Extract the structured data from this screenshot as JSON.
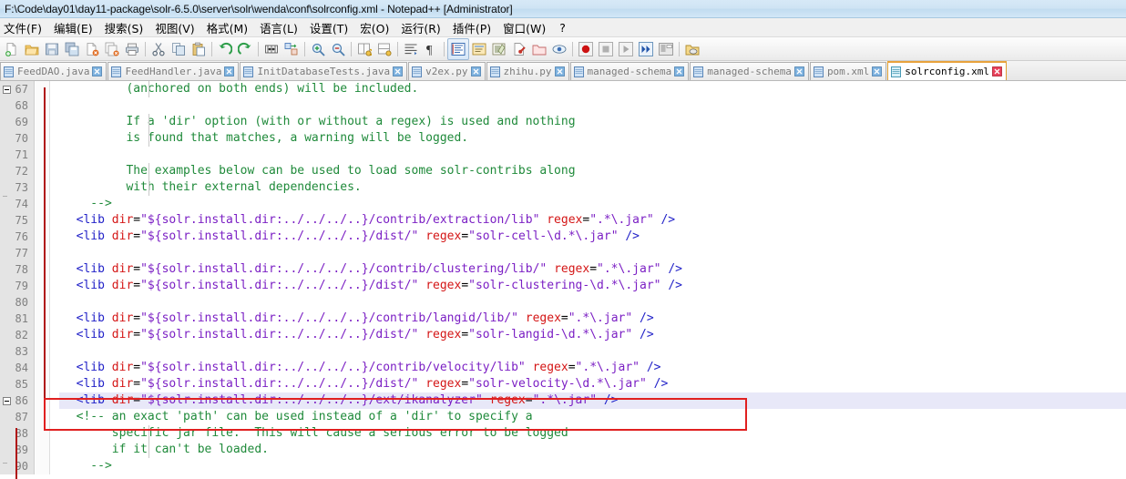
{
  "window": {
    "title": "F:\\Code\\day01\\day11-package\\solr-6.5.0\\server\\solr\\wenda\\conf\\solrconfig.xml - Notepad++ [Administrator]"
  },
  "menu": {
    "items": [
      {
        "label": "文件(F)",
        "name": "menu-file"
      },
      {
        "label": "编辑(E)",
        "name": "menu-edit"
      },
      {
        "label": "搜索(S)",
        "name": "menu-search"
      },
      {
        "label": "视图(V)",
        "name": "menu-view"
      },
      {
        "label": "格式(M)",
        "name": "menu-format"
      },
      {
        "label": "语言(L)",
        "name": "menu-language"
      },
      {
        "label": "设置(T)",
        "name": "menu-settings"
      },
      {
        "label": "宏(O)",
        "name": "menu-macro"
      },
      {
        "label": "运行(R)",
        "name": "menu-run"
      },
      {
        "label": "插件(P)",
        "name": "menu-plugins"
      },
      {
        "label": "窗口(W)",
        "name": "menu-window"
      },
      {
        "label": "?",
        "name": "menu-help"
      }
    ]
  },
  "toolbar": {
    "icons": [
      "new-file-icon",
      "open-file-icon",
      "save-icon",
      "save-all-icon",
      "close-file-icon",
      "close-all-icon",
      "print-icon",
      "sep",
      "cut-icon",
      "copy-icon",
      "paste-icon",
      "sep",
      "undo-icon",
      "redo-icon",
      "sep",
      "find-icon",
      "replace-icon",
      "sep",
      "zoom-in-icon",
      "zoom-out-icon",
      "sep",
      "sync-vertical-icon",
      "sync-horizontal-icon",
      "sep",
      "word-wrap-icon",
      "show-all-chars-icon",
      "sep",
      "indent-guide-icon",
      "ui-shift-icon",
      "show-doc-map-icon",
      "function-list-icon",
      "folder-as-workspace-icon",
      "show-whitespace-icon",
      "sep",
      "record-macro-icon",
      "stop-record-icon",
      "playback-macro-icon",
      "run-multi-macro-icon",
      "save-macro-icon",
      "sep",
      "run-icon"
    ]
  },
  "tabs": [
    {
      "label": "FeedDAO.java",
      "active": false,
      "icon": "document-icon",
      "name": "tab-feeddao-java"
    },
    {
      "label": "FeedHandler.java",
      "active": false,
      "icon": "document-icon",
      "name": "tab-feedhandler-java"
    },
    {
      "label": "InitDatabaseTests.java",
      "active": false,
      "icon": "document-icon",
      "name": "tab-initdatabasetests-java"
    },
    {
      "label": "v2ex.py",
      "active": false,
      "icon": "document-icon",
      "name": "tab-v2ex-py"
    },
    {
      "label": "zhihu.py",
      "active": false,
      "icon": "document-icon",
      "name": "tab-zhihu-py"
    },
    {
      "label": "managed-schema",
      "active": false,
      "icon": "document-icon",
      "name": "tab-managed-schema-1"
    },
    {
      "label": "managed-schema",
      "active": false,
      "icon": "document-icon",
      "name": "tab-managed-schema-2"
    },
    {
      "label": "pom.xml",
      "active": false,
      "icon": "document-icon",
      "name": "tab-pom-xml"
    },
    {
      "label": "solrconfig.xml",
      "active": true,
      "icon": "document-icon",
      "name": "tab-solrconfig-xml"
    }
  ],
  "editor": {
    "first_line_number": 67,
    "current_line_number": 86,
    "line_numbers": [
      67,
      68,
      69,
      70,
      71,
      72,
      73,
      74,
      75,
      76,
      77,
      78,
      79,
      80,
      81,
      82,
      83,
      84,
      85,
      86,
      87,
      88,
      89,
      90
    ],
    "lines": [
      {
        "n": 67,
        "segments": [
          {
            "t": "         (anchored on both ends) will be included.",
            "c": "cmt"
          }
        ]
      },
      {
        "n": 68,
        "segments": [
          {
            "t": "",
            "c": "cmt"
          }
        ]
      },
      {
        "n": 69,
        "segments": [
          {
            "t": "         If a 'dir' option (with or without a regex) is used and nothing",
            "c": "cmt"
          }
        ]
      },
      {
        "n": 70,
        "segments": [
          {
            "t": "         is found that matches, a warning will be logged.",
            "c": "cmt"
          }
        ]
      },
      {
        "n": 71,
        "segments": [
          {
            "t": "",
            "c": "cmt"
          }
        ]
      },
      {
        "n": 72,
        "segments": [
          {
            "t": "         The examples below can be used to load some solr-contribs along",
            "c": "cmt"
          }
        ]
      },
      {
        "n": 73,
        "segments": [
          {
            "t": "         with their external dependencies.",
            "c": "cmt"
          }
        ]
      },
      {
        "n": 74,
        "segments": [
          {
            "t": "    -->",
            "c": "cmt"
          }
        ]
      },
      {
        "n": 75,
        "segments": [
          {
            "t": "  <lib ",
            "c": "tag"
          },
          {
            "t": "dir",
            "c": "att"
          },
          {
            "t": "=",
            "c": "txt"
          },
          {
            "t": "\"${solr.install.dir:../../../..}/contrib/extraction/lib\"",
            "c": "val"
          },
          {
            "t": " ",
            "c": "txt"
          },
          {
            "t": "regex",
            "c": "att"
          },
          {
            "t": "=",
            "c": "txt"
          },
          {
            "t": "\".*\\.jar\"",
            "c": "val"
          },
          {
            "t": " ",
            "c": "txt"
          },
          {
            "t": "/>",
            "c": "tag"
          }
        ]
      },
      {
        "n": 76,
        "segments": [
          {
            "t": "  <lib ",
            "c": "tag"
          },
          {
            "t": "dir",
            "c": "att"
          },
          {
            "t": "=",
            "c": "txt"
          },
          {
            "t": "\"${solr.install.dir:../../../..}/dist/\"",
            "c": "val"
          },
          {
            "t": " ",
            "c": "txt"
          },
          {
            "t": "regex",
            "c": "att"
          },
          {
            "t": "=",
            "c": "txt"
          },
          {
            "t": "\"solr-cell-\\d.*\\.jar\"",
            "c": "val"
          },
          {
            "t": " ",
            "c": "txt"
          },
          {
            "t": "/>",
            "c": "tag"
          }
        ]
      },
      {
        "n": 77,
        "segments": [
          {
            "t": "",
            "c": "txt"
          }
        ]
      },
      {
        "n": 78,
        "segments": [
          {
            "t": "  <lib ",
            "c": "tag"
          },
          {
            "t": "dir",
            "c": "att"
          },
          {
            "t": "=",
            "c": "txt"
          },
          {
            "t": "\"${solr.install.dir:../../../..}/contrib/clustering/lib/\"",
            "c": "val"
          },
          {
            "t": " ",
            "c": "txt"
          },
          {
            "t": "regex",
            "c": "att"
          },
          {
            "t": "=",
            "c": "txt"
          },
          {
            "t": "\".*\\.jar\"",
            "c": "val"
          },
          {
            "t": " ",
            "c": "txt"
          },
          {
            "t": "/>",
            "c": "tag"
          }
        ]
      },
      {
        "n": 79,
        "segments": [
          {
            "t": "  <lib ",
            "c": "tag"
          },
          {
            "t": "dir",
            "c": "att"
          },
          {
            "t": "=",
            "c": "txt"
          },
          {
            "t": "\"${solr.install.dir:../../../..}/dist/\"",
            "c": "val"
          },
          {
            "t": " ",
            "c": "txt"
          },
          {
            "t": "regex",
            "c": "att"
          },
          {
            "t": "=",
            "c": "txt"
          },
          {
            "t": "\"solr-clustering-\\d.*\\.jar\"",
            "c": "val"
          },
          {
            "t": " ",
            "c": "txt"
          },
          {
            "t": "/>",
            "c": "tag"
          }
        ]
      },
      {
        "n": 80,
        "segments": [
          {
            "t": "",
            "c": "txt"
          }
        ]
      },
      {
        "n": 81,
        "segments": [
          {
            "t": "  <lib ",
            "c": "tag"
          },
          {
            "t": "dir",
            "c": "att"
          },
          {
            "t": "=",
            "c": "txt"
          },
          {
            "t": "\"${solr.install.dir:../../../..}/contrib/langid/lib/\"",
            "c": "val"
          },
          {
            "t": " ",
            "c": "txt"
          },
          {
            "t": "regex",
            "c": "att"
          },
          {
            "t": "=",
            "c": "txt"
          },
          {
            "t": "\".*\\.jar\"",
            "c": "val"
          },
          {
            "t": " ",
            "c": "txt"
          },
          {
            "t": "/>",
            "c": "tag"
          }
        ]
      },
      {
        "n": 82,
        "segments": [
          {
            "t": "  <lib ",
            "c": "tag"
          },
          {
            "t": "dir",
            "c": "att"
          },
          {
            "t": "=",
            "c": "txt"
          },
          {
            "t": "\"${solr.install.dir:../../../..}/dist/\"",
            "c": "val"
          },
          {
            "t": " ",
            "c": "txt"
          },
          {
            "t": "regex",
            "c": "att"
          },
          {
            "t": "=",
            "c": "txt"
          },
          {
            "t": "\"solr-langid-\\d.*\\.jar\"",
            "c": "val"
          },
          {
            "t": " ",
            "c": "txt"
          },
          {
            "t": "/>",
            "c": "tag"
          }
        ]
      },
      {
        "n": 83,
        "segments": [
          {
            "t": "",
            "c": "txt"
          }
        ]
      },
      {
        "n": 84,
        "segments": [
          {
            "t": "  <lib ",
            "c": "tag"
          },
          {
            "t": "dir",
            "c": "att"
          },
          {
            "t": "=",
            "c": "txt"
          },
          {
            "t": "\"${solr.install.dir:../../../..}/contrib/velocity/lib\"",
            "c": "val"
          },
          {
            "t": " ",
            "c": "txt"
          },
          {
            "t": "regex",
            "c": "att"
          },
          {
            "t": "=",
            "c": "txt"
          },
          {
            "t": "\".*\\.jar\"",
            "c": "val"
          },
          {
            "t": " ",
            "c": "txt"
          },
          {
            "t": "/>",
            "c": "tag"
          }
        ]
      },
      {
        "n": 85,
        "segments": [
          {
            "t": "  <lib ",
            "c": "tag"
          },
          {
            "t": "dir",
            "c": "att"
          },
          {
            "t": "=",
            "c": "txt"
          },
          {
            "t": "\"${solr.install.dir:../../../..}/dist/\"",
            "c": "val"
          },
          {
            "t": " ",
            "c": "txt"
          },
          {
            "t": "regex",
            "c": "att"
          },
          {
            "t": "=",
            "c": "txt"
          },
          {
            "t": "\"solr-velocity-\\d.*\\.jar\"",
            "c": "val"
          },
          {
            "t": " ",
            "c": "txt"
          },
          {
            "t": "/>",
            "c": "tag"
          }
        ]
      },
      {
        "n": 86,
        "current": true,
        "segments": [
          {
            "t": "  <lib ",
            "c": "tag"
          },
          {
            "t": "dir",
            "c": "att"
          },
          {
            "t": "=",
            "c": "txt"
          },
          {
            "t": "\"${solr.install.dir:../../../..}/ext/ikanalyzer\"",
            "c": "val"
          },
          {
            "t": " ",
            "c": "txt"
          },
          {
            "t": "regex",
            "c": "att"
          },
          {
            "t": "=",
            "c": "txt"
          },
          {
            "t": "\".*\\.jar\"",
            "c": "val"
          },
          {
            "t": " ",
            "c": "txt"
          },
          {
            "t": "/>",
            "c": "tag"
          }
        ]
      },
      {
        "n": 87,
        "segments": [
          {
            "t": "  <!-- an exact 'path' can be used instead of a 'dir' to specify a",
            "c": "cmt"
          }
        ]
      },
      {
        "n": 88,
        "segments": [
          {
            "t": "       specific jar file.  This will cause a serious error to be logged",
            "c": "cmt"
          }
        ]
      },
      {
        "n": 89,
        "segments": [
          {
            "t": "       if it can't be loaded.",
            "c": "cmt"
          }
        ]
      },
      {
        "n": 90,
        "segments": [
          {
            "t": "    -->",
            "c": "cmt"
          }
        ]
      }
    ]
  },
  "annotation": {
    "shape": "rectangle",
    "color": "#e02020",
    "target_line": 86,
    "description": "red highlight box around the ikanalyzer lib line"
  },
  "colors": {
    "comment": "#1f8a3a",
    "tag": "#2222c8",
    "attribute": "#d41616",
    "value": "#7b1fc4",
    "current_line_bg": "#e8e8f8",
    "gutter_bg": "#e4e4e4",
    "annotation_red": "#e02020",
    "active_tab_border": "#e8a33d"
  }
}
